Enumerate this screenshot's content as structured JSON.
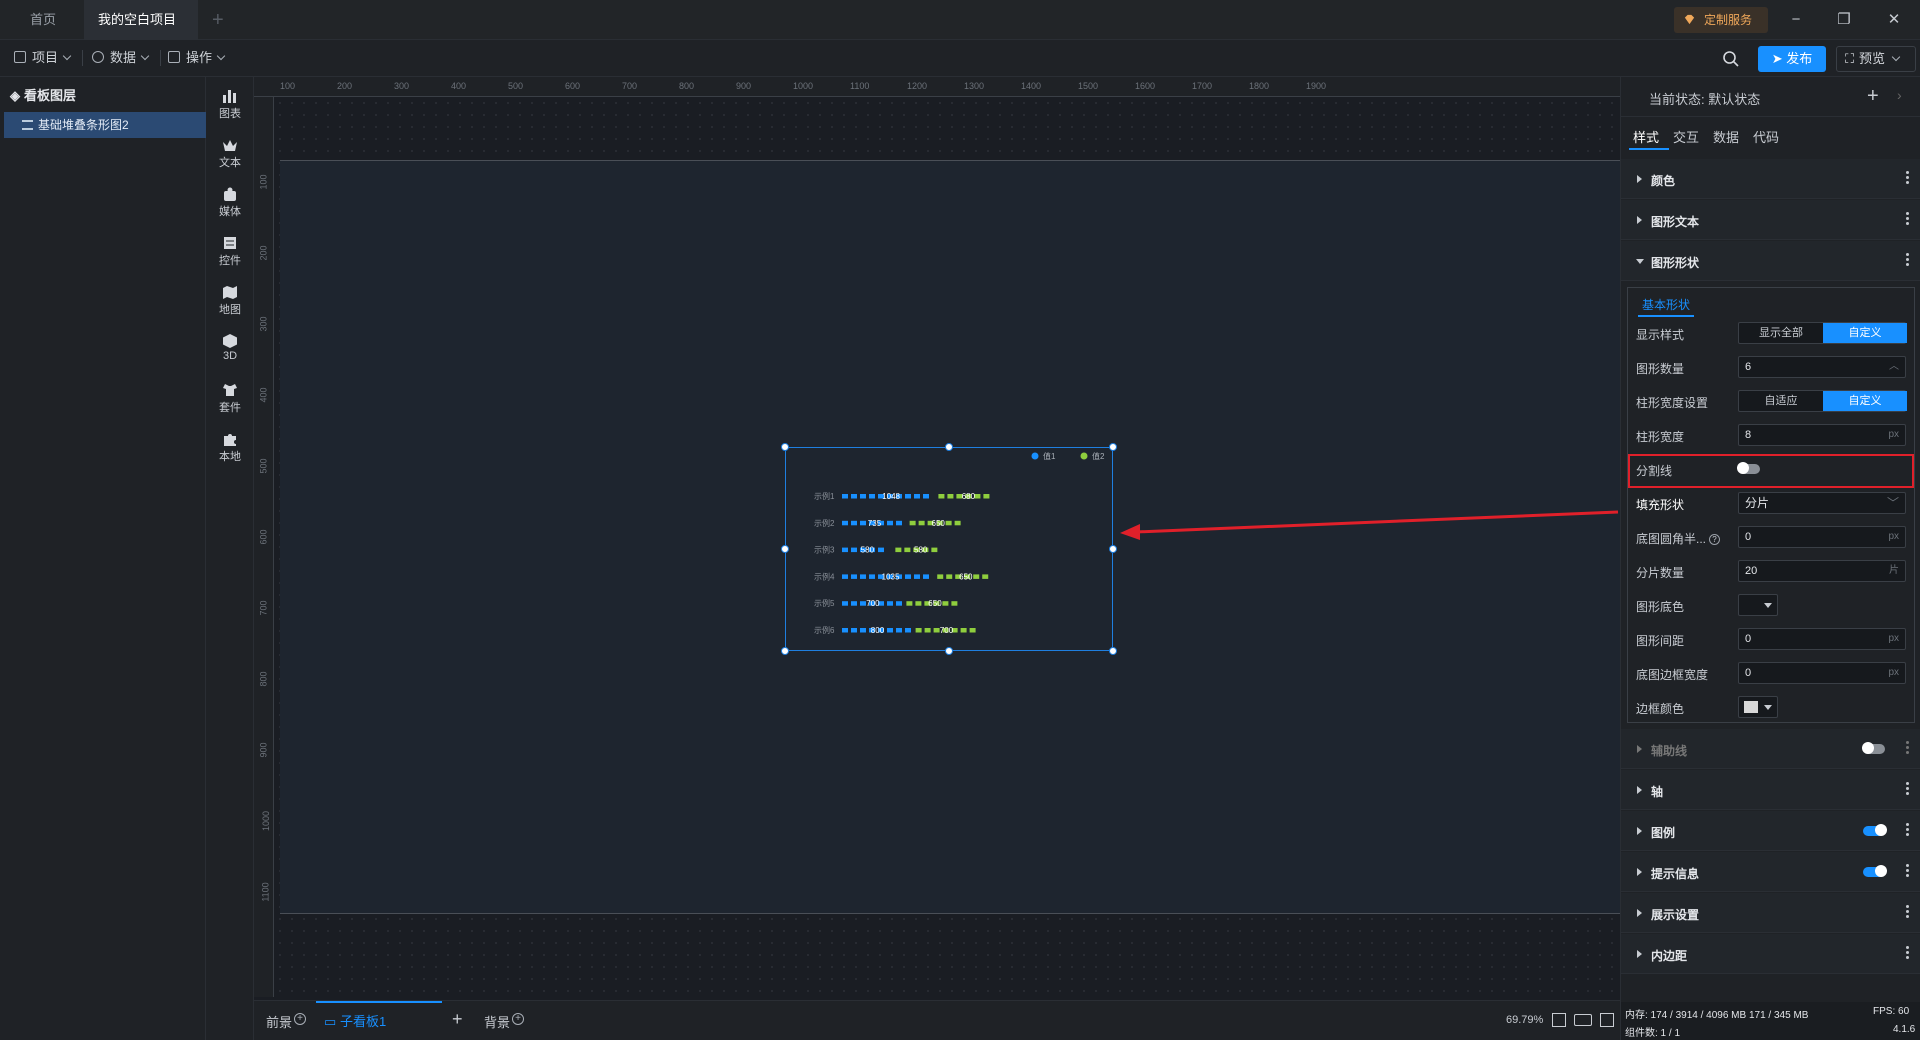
{
  "titlebar": {
    "tabs": [
      "首页",
      "我的空白项目"
    ],
    "custom_service": "定制服务"
  },
  "toolbar": {
    "menus": [
      "项目",
      "数据",
      "操作"
    ],
    "publish": "发布",
    "preview": "预览"
  },
  "layers": {
    "title": "看板图层",
    "items": [
      "基础堆叠条形图2"
    ]
  },
  "rail": [
    "图表",
    "文本",
    "媒体",
    "控件",
    "地图",
    "3D",
    "套件",
    "本地"
  ],
  "ruler_top": [
    "100",
    "200",
    "300",
    "400",
    "500",
    "600",
    "700",
    "800",
    "900",
    "1000",
    "1100",
    "1200",
    "1300",
    "1400",
    "1500",
    "1600",
    "1700",
    "1800",
    "1900"
  ],
  "ruler_left": [
    "100",
    "200",
    "300",
    "400",
    "500",
    "600",
    "700",
    "800",
    "900",
    "1000",
    "1100"
  ],
  "chart_data": {
    "type": "bar",
    "orientation": "horizontal",
    "stacked": true,
    "fill_shape": "segmented",
    "categories": [
      "示例1",
      "示例2",
      "示例3",
      "示例4",
      "示例5",
      "示例6"
    ],
    "series": [
      {
        "name": "值1",
        "values": [
          1048,
          735,
          580,
          1035,
          700,
          800
        ],
        "color": "#1890ff"
      },
      {
        "name": "值2",
        "values": [
          680,
          650,
          580,
          650,
          650,
          700
        ],
        "color": "#8fce3e"
      }
    ],
    "legend_position": "top-right"
  },
  "bottombar": {
    "front": "前景",
    "sub_board": "子看板1",
    "add": "+",
    "background": "背景",
    "zoom": "69.79%"
  },
  "rpanel": {
    "state": "当前状态:  默认状态",
    "tabs": [
      "样式",
      "交互",
      "数据",
      "代码"
    ],
    "sections": {
      "color": "颜色",
      "text": "图形文本",
      "shape": "图形形状",
      "guide": "辅助线",
      "axis": "轴",
      "legend": "图例",
      "tooltip": "提示信息",
      "display": "展示设置",
      "padding": "内边距"
    },
    "shape": {
      "subtab": "基本形状",
      "display_style_label": "显示样式",
      "display_style_options": [
        "显示全部",
        "自定义"
      ],
      "count_label": "图形数量",
      "count_value": "6",
      "bar_width_setting_label": "柱形宽度设置",
      "bar_width_setting_options": [
        "自适应",
        "自定义"
      ],
      "bar_width_label": "柱形宽度",
      "bar_width_value": "8",
      "bar_width_unit": "px",
      "divider_label": "分割线",
      "fill_shape_label": "填充形状",
      "fill_shape_value": "分片",
      "radius_label": "底图圆角半...",
      "radius_value": "0",
      "radius_unit": "px",
      "slice_count_label": "分片数量",
      "slice_count_value": "20",
      "slice_count_unit": "片",
      "base_color_label": "图形底色",
      "gap_label": "图形间距",
      "gap_value": "0",
      "gap_unit": "px",
      "border_width_label": "底图边框宽度",
      "border_width_value": "0",
      "border_width_unit": "px",
      "border_color_label": "边框颜色"
    },
    "status": {
      "memory": "内存:  174 / 3914 / 4096 MB  171 / 345 MB",
      "fps": "FPS:  60",
      "components": "组件数: 1 / 1",
      "version": "4.1.6"
    }
  }
}
